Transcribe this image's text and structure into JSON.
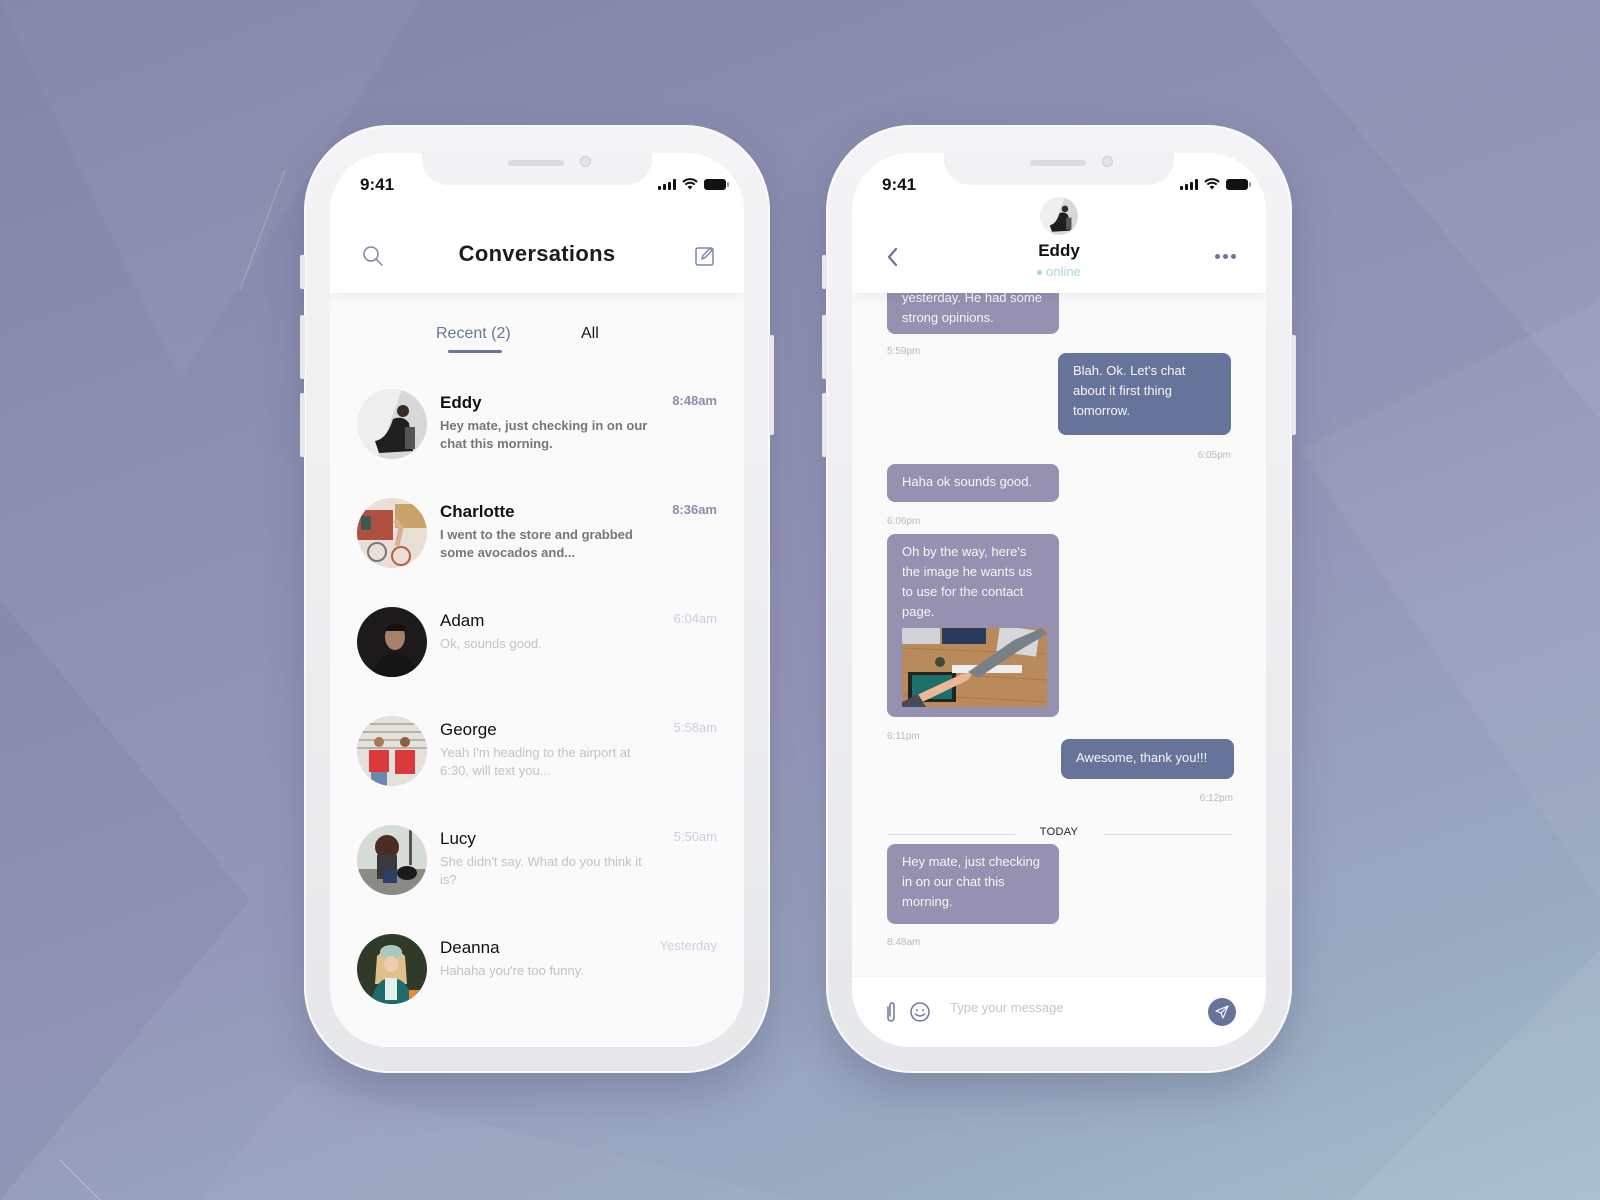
{
  "status_bar": {
    "time": "9:41"
  },
  "conversations_screen": {
    "title": "Conversations",
    "tabs": [
      {
        "label": "Recent (2)",
        "active": true
      },
      {
        "label": "All",
        "active": false
      }
    ],
    "items": [
      {
        "name": "Eddy",
        "preview": "Hey mate, just checking in on our chat this morning.",
        "time": "8:48am",
        "unread": true,
        "avatar": "eddy-photo"
      },
      {
        "name": "Charlotte",
        "preview": "I went to the store and grabbed some avocados and...",
        "time": "8:36am",
        "unread": true,
        "avatar": "charlotte-photo"
      },
      {
        "name": "Adam",
        "preview": "Ok, sounds good.",
        "time": "6:04am",
        "unread": false,
        "avatar": "adam-photo"
      },
      {
        "name": "George",
        "preview": "Yeah I'm heading to the airport at 6:30, will text you...",
        "time": "5:58am",
        "unread": false,
        "avatar": "george-photo"
      },
      {
        "name": "Lucy",
        "preview": "She didn't say. What do you think it is?",
        "time": "5:50am",
        "unread": false,
        "avatar": "lucy-photo"
      },
      {
        "name": "Deanna",
        "preview": "Hahaha you're too funny.",
        "time": "Yesterday",
        "unread": false,
        "avatar": "deanna-photo"
      }
    ]
  },
  "chat_screen": {
    "contact_name": "Eddy",
    "presence": "online",
    "messages": [
      {
        "direction": "in",
        "text": "yesterday. He had some strong opinions.",
        "time": "5:59pm"
      },
      {
        "direction": "out",
        "text": "Blah. Ok. Let's chat about it first thing tomorrow.",
        "time": "6:05pm"
      },
      {
        "direction": "in",
        "text": "Haha ok sounds good.",
        "time": "6:06pm"
      },
      {
        "direction": "in",
        "text": "Oh by the way, here's the image he wants us to use for the contact page.",
        "time": "6:11pm",
        "attachment": "handshake-photo"
      },
      {
        "direction": "out",
        "text": "Awesome, thank you!!!",
        "time": "6:12pm"
      },
      {
        "direction": "in",
        "text": "Hey mate, just checking in on our chat this morning.",
        "time": "8:48am"
      }
    ],
    "day_divider": "TODAY",
    "composer": {
      "placeholder": "Type your message"
    }
  },
  "colors": {
    "accent": "#6b7599",
    "incoming_bubble": "#9691b0",
    "outgoing_bubble": "#67749a",
    "online": "#a6d7de"
  }
}
